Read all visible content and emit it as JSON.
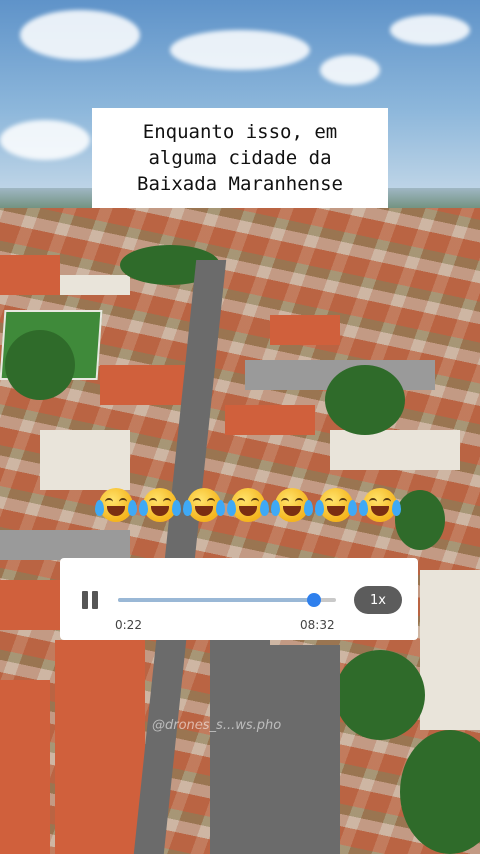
{
  "caption": {
    "text": "Enquanto isso, em\nalguma cidade da\nBaixada Maranhense"
  },
  "reaction": {
    "emoji": "😂",
    "count": 7,
    "icon_name": "face-with-tears-of-joy-icon"
  },
  "player": {
    "current_time": "0:22",
    "duration": "08:32",
    "speed_label": "1x",
    "progress": 0.9,
    "accent_color": "#2f80ed"
  },
  "watermark": {
    "text": "@drones_s...ws.pho"
  }
}
